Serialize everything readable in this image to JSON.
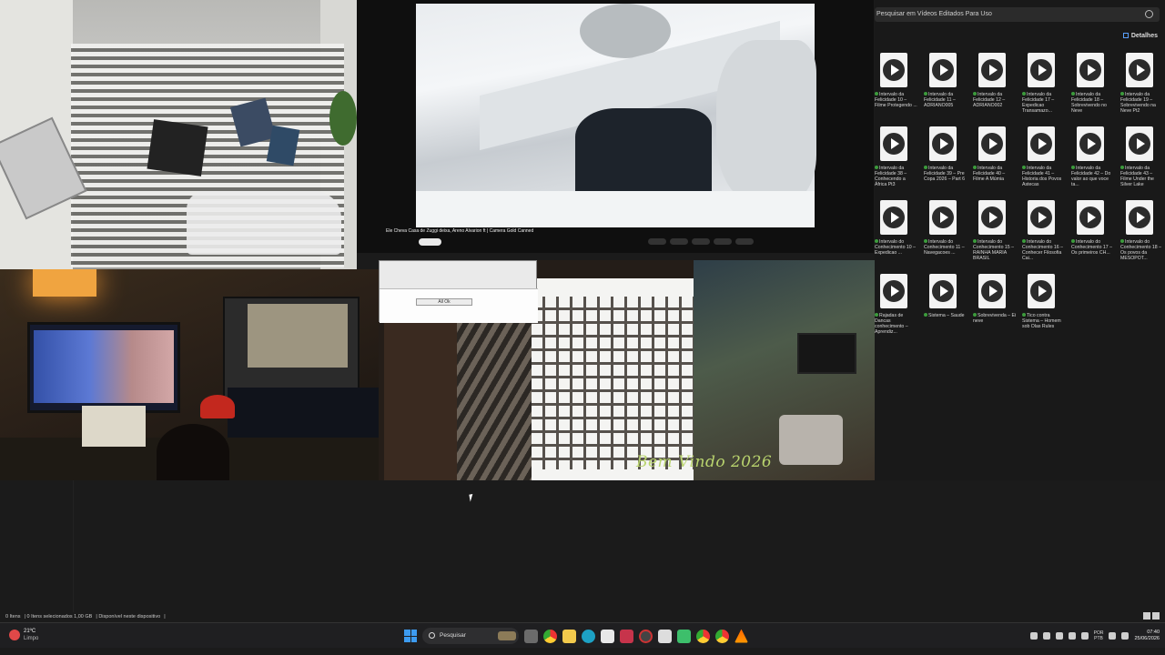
{
  "youtube": {
    "video_title": "Ele Cheva Casa de Zuggi deixa, Areno Alvarion ft | Camera Gold Canned",
    "subscribe_label": "",
    "action_labels": [
      "",
      "",
      "",
      "",
      ""
    ]
  },
  "camera_room": {
    "dialog_button": "All Ok",
    "watermark": "Bem Vindo 2026"
  },
  "explorer": {
    "search_placeholder": "Pesquisar em Vídeos Editados Para Uso",
    "details_label": "Detalhes",
    "files": [
      "Intervalo da Felicidade 10 – Filme Protegendo ...",
      "Intervalo da Felicidade 11 – ADRIANO005",
      "Intervalo da Felicidade 12 – ADRIANO002",
      "Intervalo da Felicidade 17 – Expedicao Transamazo...",
      "Intervalo da Felicidade 18 – Sobrevivendo no Neve",
      "Intervalo da Felicidade 19 – Sobrevivendo na Neve Pt2",
      "Intervalo da Felicidade 38 – Conhecendo a África Pt3",
      "Intervalo da Felicidade 39 – Pre Copa 2026 – Part 6",
      "Intervalo da Felicidade 40 – Filme A Múmia",
      "Intervalo da Felicidade 41 – Historia dos Povos Astecas",
      "Intervalo da Felicidade 42 – Do valor ao que voce ta...",
      "Intervalo da Felicidade 43 – Filme Under the Silver Lake",
      "Intervalo do Conhecimento 10 – Expedicao ...",
      "Intervalo do Conhecimento 11 – Navegacoes ...",
      "Intervalo do Conhecimento 15 – RAINHA MARIA BRASIL",
      "Intervalo do Conhecimento 16 – Conhecer Filosofia Cai...",
      "Intervalo do Conhecimento 17 – Os primeiros CH...",
      "Intervalo do Conhecimento 18 – Os povos da MESOPOT...",
      "Rajadas de Dancas conhecimento – Aprendiz...",
      "Sistema – Saude",
      "Sobrevivenda – Ei neve",
      "Tico contra Sistema – Homem sob Olas Rules"
    ]
  },
  "status_bar": {
    "items": "0 Itens",
    "selected": "0 Itens selecionados 1,00 GB",
    "availability": "Disponível neste dispositivo"
  },
  "taskbar": {
    "weather_temp": "21ºC",
    "weather_cond": "Limpo",
    "search_placeholder": "Pesquisar",
    "lang_line1": "POR",
    "lang_line2": "PTB",
    "time": "07:40",
    "date": "25/06/2026"
  },
  "colors": {
    "accent": "#3d9bf0",
    "watermark": "#b9d46e",
    "taskbar_bg": "#1f1f21",
    "explorer_bg": "#191919"
  }
}
